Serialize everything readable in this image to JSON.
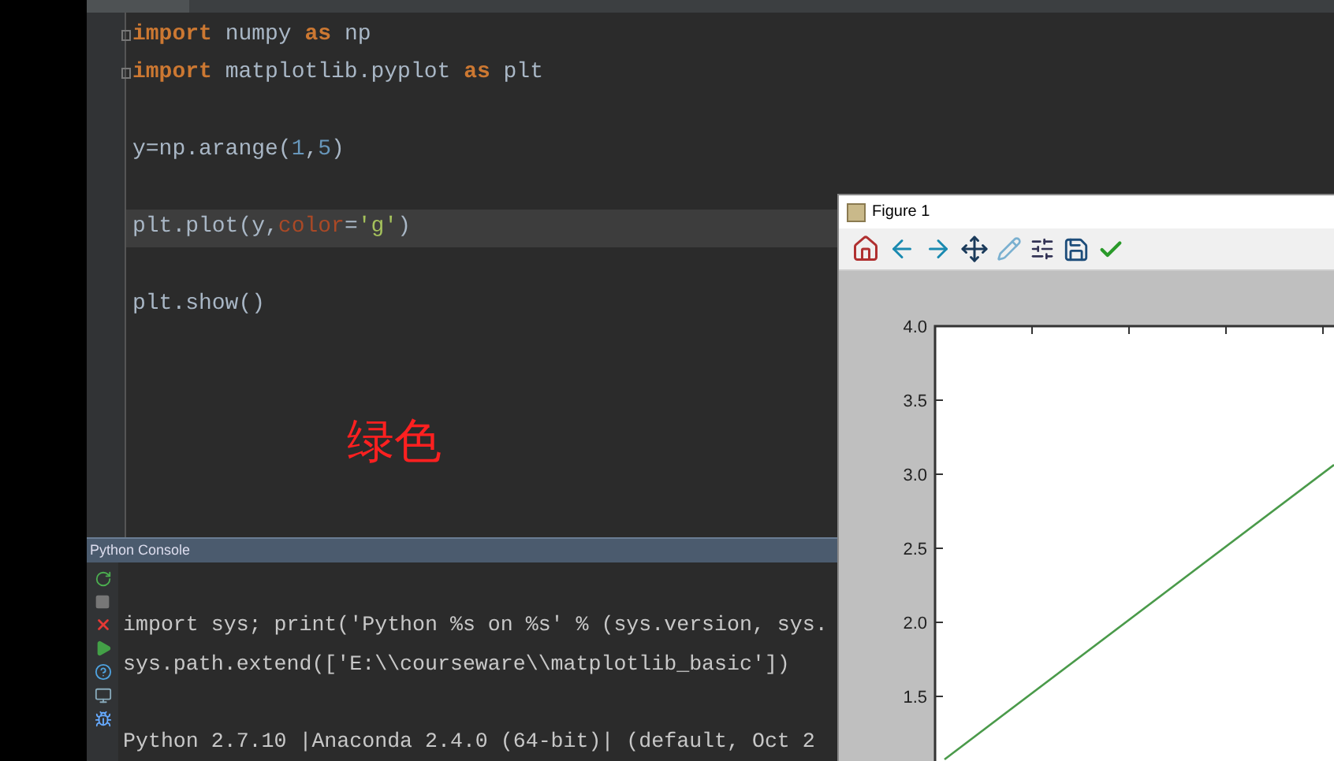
{
  "editor": {
    "lines": [
      {
        "kind": "code",
        "current": false,
        "folded": true,
        "tokens": [
          {
            "kind": "keyword",
            "text": "import"
          },
          {
            "kind": "plain",
            "text": " numpy "
          },
          {
            "kind": "keyword",
            "text": "as"
          },
          {
            "kind": "plain",
            "text": " np"
          }
        ]
      },
      {
        "kind": "code",
        "current": false,
        "folded": true,
        "tokens": [
          {
            "kind": "keyword",
            "text": "import"
          },
          {
            "kind": "plain",
            "text": " matplotlib.pyplot "
          },
          {
            "kind": "keyword",
            "text": "as"
          },
          {
            "kind": "plain",
            "text": " plt"
          }
        ]
      },
      {
        "kind": "blank"
      },
      {
        "kind": "code",
        "current": false,
        "folded": false,
        "tokens": [
          {
            "kind": "plain",
            "text": "y=np.arange("
          },
          {
            "kind": "number",
            "text": "1"
          },
          {
            "kind": "plain",
            "text": ","
          },
          {
            "kind": "number",
            "text": "5"
          },
          {
            "kind": "plain",
            "text": ")"
          }
        ]
      },
      {
        "kind": "blank"
      },
      {
        "kind": "code",
        "current": true,
        "folded": false,
        "tokens": [
          {
            "kind": "plain",
            "text": "plt.plot(y,"
          },
          {
            "kind": "param",
            "text": "color"
          },
          {
            "kind": "plain",
            "text": "="
          },
          {
            "kind": "string",
            "text": "'g'"
          },
          {
            "kind": "plain",
            "text": ")"
          }
        ]
      },
      {
        "kind": "blank"
      },
      {
        "kind": "code",
        "current": false,
        "folded": false,
        "tokens": [
          {
            "kind": "plain",
            "text": "plt.show()"
          }
        ]
      }
    ]
  },
  "annotation": "绿色",
  "console": {
    "title": "Python Console",
    "lines": [
      {
        "kind": "blank"
      },
      {
        "kind": "text",
        "text": "import sys; print('Python %s on %s' % (sys.version, sys."
      },
      {
        "kind": "text",
        "text": "sys.path.extend(['E:\\\\courseware\\\\matplotlib_basic'])"
      },
      {
        "kind": "blank"
      },
      {
        "kind": "text",
        "text": "Python 2.7.10 |Anaconda 2.4.0 (64-bit)| (default, Oct 2"
      }
    ]
  },
  "figure": {
    "title": "Figure 1",
    "y_tick_labels": [
      "4.0",
      "3.5",
      "3.0",
      "2.5",
      "2.0",
      "1.5"
    ]
  }
}
